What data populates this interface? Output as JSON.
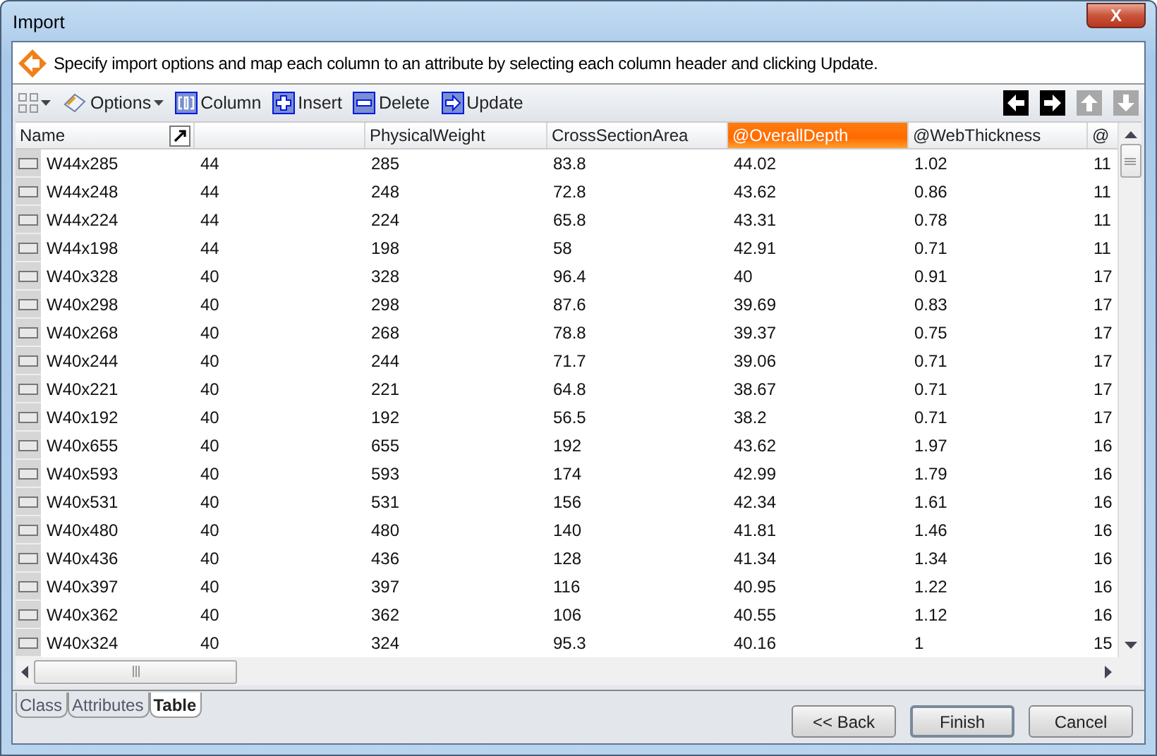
{
  "window": {
    "title": "Import",
    "close": "X"
  },
  "info": "Specify import options and map each column to an attribute by selecting each column header and clicking Update.",
  "toolbar": [
    {
      "kind": "grid",
      "dropdown": true
    },
    {
      "kind": "options",
      "label": "Options",
      "dropdown": true
    },
    {
      "kind": "column",
      "label": "Column",
      "dropdown": false
    },
    {
      "kind": "insert",
      "label": "Insert",
      "dropdown": false
    },
    {
      "kind": "delete",
      "label": "Delete",
      "dropdown": false
    },
    {
      "kind": "update",
      "label": "Update",
      "dropdown": false
    }
  ],
  "nav": [
    {
      "kind": "left",
      "disabled": false
    },
    {
      "kind": "right",
      "disabled": false
    },
    {
      "kind": "up",
      "disabled": true
    },
    {
      "kind": "down",
      "disabled": true
    }
  ],
  "table": {
    "columns": [
      {
        "label": "Name",
        "selected": false
      },
      {
        "selected": false
      },
      {
        "label": "PhysicalWeight",
        "selected": false
      },
      {
        "label": "CrossSectionArea",
        "selected": false
      },
      {
        "label": "@OverallDepth",
        "selected": true
      },
      {
        "label": "@WebThickness",
        "selected": false
      },
      {
        "label": "@",
        "selected": false
      }
    ],
    "rows": [
      [
        "W44x285",
        "44",
        "285",
        "83.8",
        "44.02",
        "1.02",
        "11"
      ],
      [
        "W44x248",
        "44",
        "248",
        "72.8",
        "43.62",
        "0.86",
        "11"
      ],
      [
        "W44x224",
        "44",
        "224",
        "65.8",
        "43.31",
        "0.78",
        "11"
      ],
      [
        "W44x198",
        "44",
        "198",
        "58",
        "42.91",
        "0.71",
        "11"
      ],
      [
        "W40x328",
        "40",
        "328",
        "96.4",
        "40",
        "0.91",
        "17"
      ],
      [
        "W40x298",
        "40",
        "298",
        "87.6",
        "39.69",
        "0.83",
        "17"
      ],
      [
        "W40x268",
        "40",
        "268",
        "78.8",
        "39.37",
        "0.75",
        "17"
      ],
      [
        "W40x244",
        "40",
        "244",
        "71.7",
        "39.06",
        "0.71",
        "17"
      ],
      [
        "W40x221",
        "40",
        "221",
        "64.8",
        "38.67",
        "0.71",
        "17"
      ],
      [
        "W40x192",
        "40",
        "192",
        "56.5",
        "38.2",
        "0.71",
        "17"
      ],
      [
        "W40x655",
        "40",
        "655",
        "192",
        "43.62",
        "1.97",
        "16"
      ],
      [
        "W40x593",
        "40",
        "593",
        "174",
        "42.99",
        "1.79",
        "16"
      ],
      [
        "W40x531",
        "40",
        "531",
        "156",
        "42.34",
        "1.61",
        "16"
      ],
      [
        "W40x480",
        "40",
        "480",
        "140",
        "41.81",
        "1.46",
        "16"
      ],
      [
        "W40x436",
        "40",
        "436",
        "128",
        "41.34",
        "1.34",
        "16"
      ],
      [
        "W40x397",
        "40",
        "397",
        "116",
        "40.95",
        "1.22",
        "16"
      ],
      [
        "W40x362",
        "40",
        "362",
        "106",
        "40.55",
        "1.12",
        "16"
      ],
      [
        "W40x324",
        "40",
        "324",
        "95.3",
        "40.16",
        "1",
        "15"
      ]
    ]
  },
  "tabs": [
    {
      "label": "Class",
      "selected": false
    },
    {
      "label": "Attributes",
      "selected": false
    },
    {
      "label": "Table",
      "selected": true
    }
  ],
  "buttons": [
    {
      "label": "<< Back",
      "default": false
    },
    {
      "label": "Finish",
      "default": true
    },
    {
      "label": "Cancel",
      "default": false
    }
  ]
}
